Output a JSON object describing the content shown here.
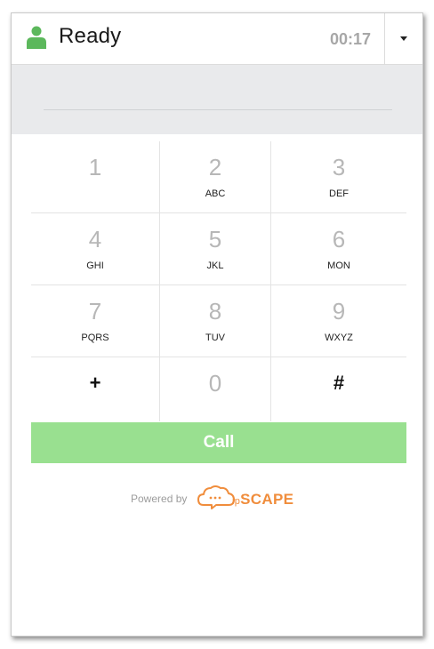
{
  "header": {
    "status": "Ready",
    "timer": "00:17",
    "status_color": "#5cb85c"
  },
  "dialer": {
    "number_value": "",
    "number_placeholder": ""
  },
  "keypad": {
    "rows": [
      [
        {
          "digit": "1",
          "letters": ""
        },
        {
          "digit": "2",
          "letters": "ABC"
        },
        {
          "digit": "3",
          "letters": "DEF"
        }
      ],
      [
        {
          "digit": "4",
          "letters": "GHI"
        },
        {
          "digit": "5",
          "letters": "JKL"
        },
        {
          "digit": "6",
          "letters": "MON"
        }
      ],
      [
        {
          "digit": "7",
          "letters": "PQRS"
        },
        {
          "digit": "8",
          "letters": "TUV"
        },
        {
          "digit": "9",
          "letters": "WXYZ"
        }
      ],
      [
        {
          "symbol": "+"
        },
        {
          "digit": "0"
        },
        {
          "symbol": "#"
        }
      ]
    ]
  },
  "call_button": {
    "label": "Call",
    "color": "#99e090"
  },
  "footer": {
    "powered_by": "Powered by",
    "brand_prefix": "ip",
    "brand_name": "SCAPE",
    "brand_color": "#f08d3c"
  }
}
